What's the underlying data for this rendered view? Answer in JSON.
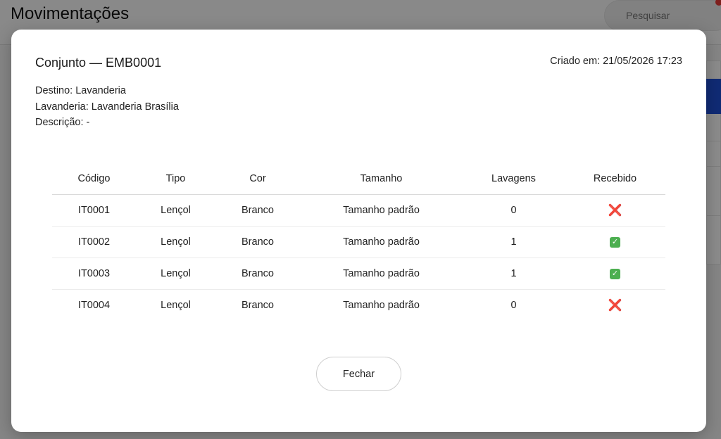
{
  "background": {
    "page_title": "Movimentações",
    "search_placeholder": "Pesquisar"
  },
  "modal": {
    "title": "Conjunto — EMB0001",
    "created": "Criado em: 21/05/2026 17:23",
    "destination": "Destino: Lavanderia",
    "laundry": "Lavanderia: Lavanderia Brasília",
    "description": "Descrição: -",
    "close_label": "Fechar"
  },
  "table": {
    "headers": [
      "Código",
      "Tipo",
      "Cor",
      "Tamanho",
      "Lavagens",
      "Recebido"
    ],
    "rows": [
      {
        "code": "IT0001",
        "type": "Lençol",
        "color": "Branco",
        "size": "Tamanho padrão",
        "washes": "0",
        "received": "❌"
      },
      {
        "code": "IT0002",
        "type": "Lençol",
        "color": "Branco",
        "size": "Tamanho padrão",
        "washes": "1",
        "received": "✓"
      },
      {
        "code": "IT0003",
        "type": "Lençol",
        "color": "Branco",
        "size": "Tamanho padrão",
        "washes": "1",
        "received": "✓"
      },
      {
        "code": "IT0004",
        "type": "Lençol",
        "color": "Branco",
        "size": "Tamanho padrão",
        "washes": "0",
        "received": "❌"
      }
    ]
  }
}
